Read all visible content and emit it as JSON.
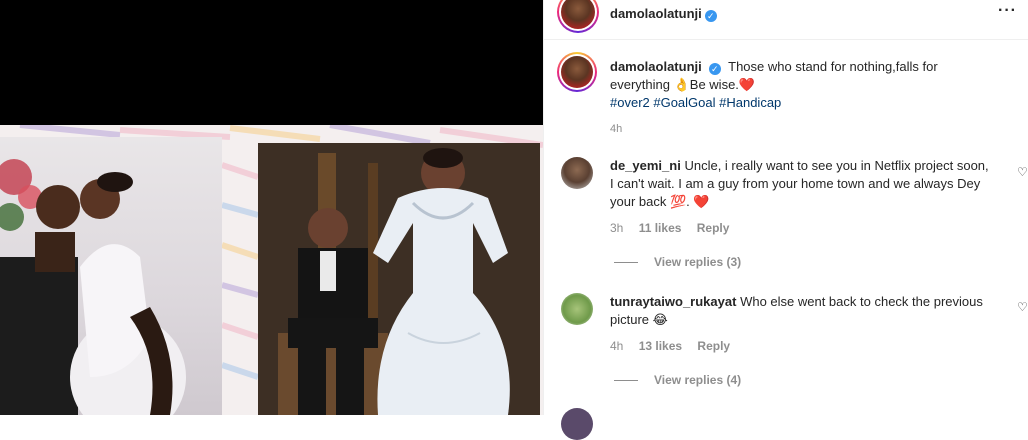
{
  "post": {
    "author": "damolaolatunji",
    "caption_text": "Those who stand for nothing,falls for everything 👌Be wise.",
    "caption_heart": "❤️",
    "hashtags": "#over2 #GoalGoal #Handicap",
    "time": "4h"
  },
  "icons": {
    "more": "more-options-icon",
    "verified": "verified-badge-icon",
    "like": "heart-outline-icon"
  },
  "comments": [
    {
      "username": "de_yemi_ni",
      "text": "Uncle, i really want to see you in Netflix project soon, I can't wait. I am a guy from your home town and we always Dey your back 💯.",
      "heart": "❤️",
      "time": "3h",
      "likes": "11 likes",
      "reply_label": "Reply",
      "view_replies": "View replies (3)"
    },
    {
      "username": "tunraytaiwo_rukayat",
      "text": "Who else went back to check the previous picture 😂",
      "time": "4h",
      "likes": "13 likes",
      "reply_label": "Reply",
      "view_replies": "View replies (4)"
    }
  ],
  "colors": {
    "link_blue": "#00376b",
    "verified_blue": "#3897f0",
    "secondary_text": "#8e8e8e",
    "heart_red": "#ed4956"
  }
}
